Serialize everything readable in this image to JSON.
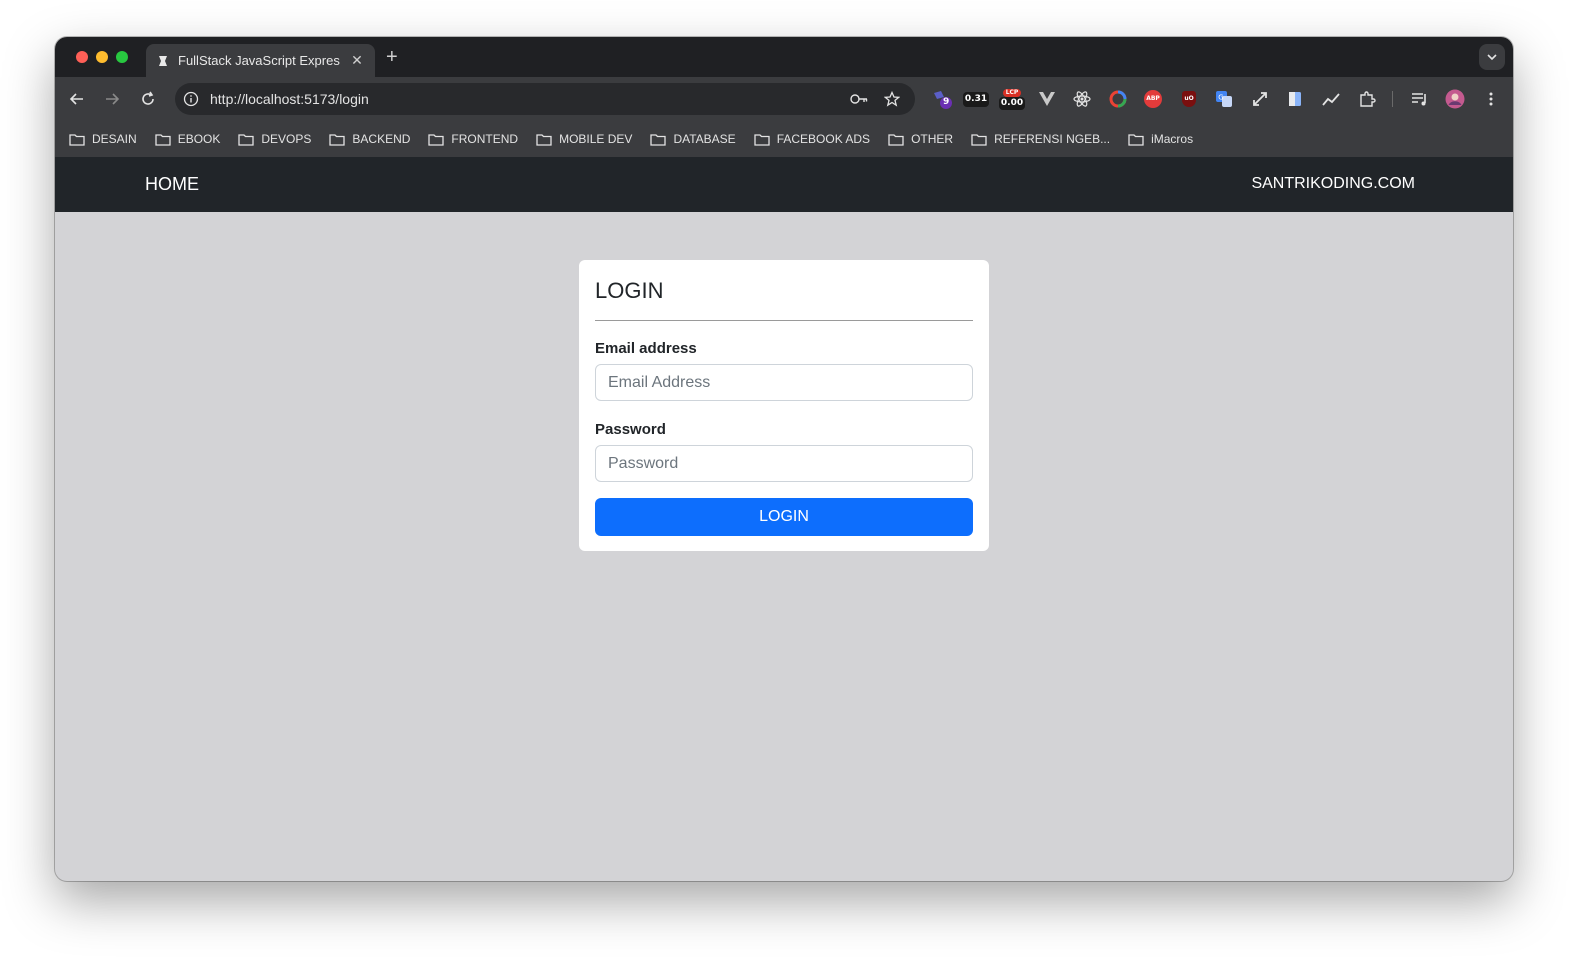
{
  "browser": {
    "tab_title": "FullStack JavaScript Express",
    "tab_close": "✕",
    "new_tab": "+",
    "url": "http://localhost:5173/login",
    "extensions": {
      "badge_nine": "9",
      "metric_cls": "0.31",
      "metric_lcp_label": "LCP",
      "metric_lcp": "0.00",
      "adblock": "ABP",
      "ublock": "uO"
    },
    "bookmarks": [
      {
        "label": "DESAIN"
      },
      {
        "label": "EBOOK"
      },
      {
        "label": "DEVOPS"
      },
      {
        "label": "BACKEND"
      },
      {
        "label": "FRONTEND"
      },
      {
        "label": "MOBILE DEV"
      },
      {
        "label": "DATABASE"
      },
      {
        "label": "FACEBOOK ADS"
      },
      {
        "label": "OTHER"
      },
      {
        "label": "REFERENSI NGEB..."
      },
      {
        "label": "iMacros"
      }
    ]
  },
  "navbar": {
    "home": "HOME",
    "site": "SANTRIKODING.COM"
  },
  "login": {
    "title": "LOGIN",
    "email_label": "Email address",
    "email_placeholder": "Email Address",
    "email_value": "",
    "password_label": "Password",
    "password_placeholder": "Password",
    "password_value": "",
    "submit_label": "LOGIN"
  },
  "colors": {
    "primary": "#0d6efd",
    "navbar_bg": "#212529",
    "page_bg": "#d3d3d6"
  }
}
